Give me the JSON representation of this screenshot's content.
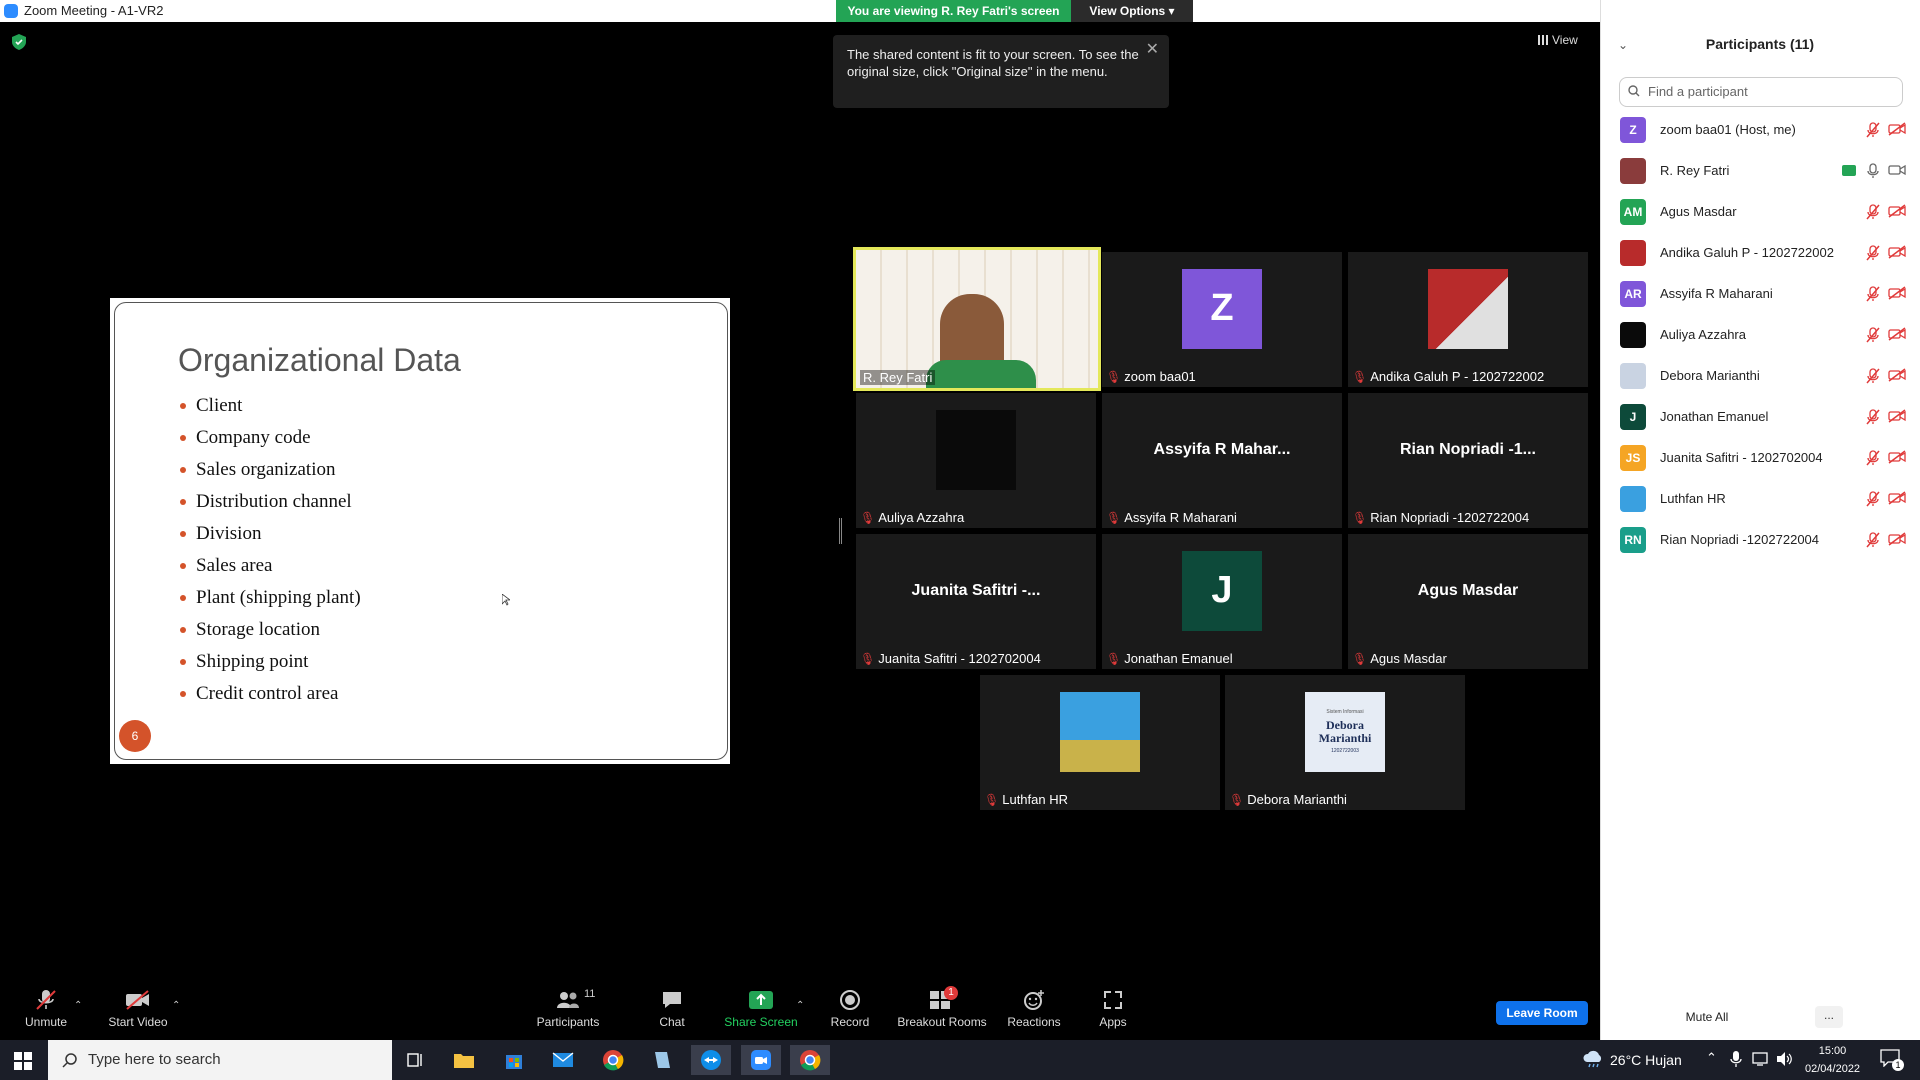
{
  "window": {
    "title": "Zoom Meeting - A1-VR2"
  },
  "banner": {
    "viewing": "You are viewing R. Rey Fatri's screen",
    "view_options": "View Options ▾"
  },
  "view_button": "View",
  "tooltip": {
    "text": "The shared content is fit to your screen. To see the original size, click \"Original size\" in the menu."
  },
  "slide": {
    "title": "Organizational Data",
    "bullets": [
      "Client",
      "Company code",
      "Sales organization",
      "Distribution channel",
      "Division",
      "Sales area",
      "Plant (shipping plant)",
      "Storage location",
      "Shipping point",
      "Credit control area"
    ],
    "page": "6",
    "accent": "#d4532a"
  },
  "tiles": [
    {
      "name": "R. Rey Fatri",
      "muted": false,
      "type": "video"
    },
    {
      "name": "zoom baa01",
      "muted": true,
      "type": "avatar",
      "initial": "Z",
      "color": "#7f56d9"
    },
    {
      "name": "Andika Galuh P - 1202722002",
      "muted": true,
      "type": "photo"
    },
    {
      "name": "Auliya Azzahra",
      "muted": true,
      "type": "blank"
    },
    {
      "name": "Assyifa R Maharani",
      "muted": true,
      "type": "text",
      "display": "Assyifa R Mahar..."
    },
    {
      "name": "Rian Nopriadi -1202722004",
      "muted": true,
      "type": "text",
      "display": "Rian Nopriadi -1..."
    },
    {
      "name": "Juanita Safitri - 1202702004",
      "muted": true,
      "type": "text",
      "display": "Juanita Safitri -..."
    },
    {
      "name": "Jonathan Emanuel",
      "muted": true,
      "type": "avatar",
      "initial": "J",
      "color": "#0d4a3a"
    },
    {
      "name": "Agus Masdar",
      "muted": true,
      "type": "text",
      "display": "Agus Masdar"
    },
    {
      "name": "Luthfan HR",
      "muted": true,
      "type": "photo2"
    },
    {
      "name": "Debora Marianthi",
      "muted": true,
      "type": "photo3",
      "display": "Debora Marianthi",
      "small": "Sistem Informasi",
      "id": "1202722003"
    }
  ],
  "participants": {
    "title": "Participants (11)",
    "search_placeholder": "Find a participant",
    "list": [
      {
        "name": "zoom baa01 (Host, me)",
        "initials": "Z",
        "color": "#7f56d9"
      },
      {
        "name": "R. Rey Fatri",
        "initials": "",
        "color": "#8a3c3c"
      },
      {
        "name": "Agus Masdar",
        "initials": "AM",
        "color": "#23a455"
      },
      {
        "name": "Andika Galuh P - 1202722002",
        "initials": "",
        "color": "#b82b2b"
      },
      {
        "name": "Assyifa R Maharani",
        "initials": "AR",
        "color": "#7f56d9"
      },
      {
        "name": "Auliya Azzahra",
        "initials": "",
        "color": "#0a0a0a"
      },
      {
        "name": "Debora Marianthi",
        "initials": "",
        "color": "#c9d3e2"
      },
      {
        "name": "Jonathan Emanuel",
        "initials": "J",
        "color": "#0d4a3a"
      },
      {
        "name": "Juanita Safitri - 1202702004",
        "initials": "JS",
        "color": "#f5a524"
      },
      {
        "name": "Luthfan HR",
        "initials": "",
        "color": "#3aa0e0"
      },
      {
        "name": "Rian Nopriadi -1202722004",
        "initials": "RN",
        "color": "#1a9e8a"
      }
    ],
    "mute_all": "Mute All",
    "more": "..."
  },
  "toolbar": {
    "unmute": "Unmute",
    "start_video": "Start Video",
    "participants": "Participants",
    "participants_count": "11",
    "chat": "Chat",
    "share_screen": "Share Screen",
    "record": "Record",
    "breakout_rooms": "Breakout Rooms",
    "breakout_badge": "1",
    "reactions": "Reactions",
    "apps": "Apps",
    "leave": "Leave Room"
  },
  "taskbar": {
    "search_placeholder": "Type here to search",
    "weather": "26°C  Hujan",
    "time": "15:00",
    "date": "02/04/2022",
    "notif_count": "1"
  }
}
